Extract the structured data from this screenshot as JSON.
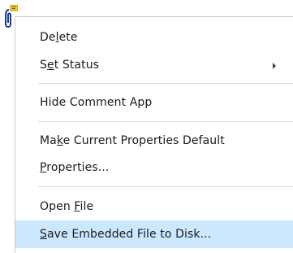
{
  "attachment_icon": "paperclip-attachment-icon",
  "menu": {
    "items": [
      {
        "pre": "De",
        "key": "l",
        "post": "ete"
      },
      {
        "pre": "S",
        "key": "e",
        "post": "t Status"
      },
      {
        "text": "Hide Comment App"
      },
      {
        "pre": "Ma",
        "key": "k",
        "post": "e Current Properties Default"
      },
      {
        "pre": "",
        "key": "P",
        "post": "roperties..."
      },
      {
        "pre": "Open ",
        "key": "F",
        "post": "ile"
      },
      {
        "pre": "",
        "key": "S",
        "post": "ave Embedded File to Disk..."
      }
    ],
    "submenu_arrow_icon": "chevron-right-icon",
    "highlight_color": "#cce8ff"
  }
}
